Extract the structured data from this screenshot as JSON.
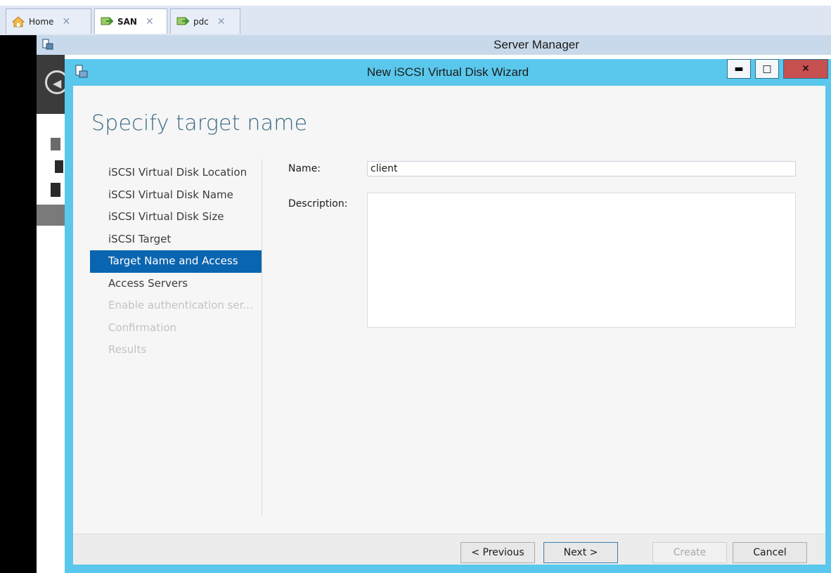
{
  "tabs": [
    {
      "label": "Home",
      "icon": "home-icon",
      "active": false
    },
    {
      "label": "SAN",
      "icon": "vm-icon",
      "active": true
    },
    {
      "label": "pdc",
      "icon": "vm-icon",
      "active": false
    }
  ],
  "tab_close_glyph": "✕",
  "server_manager": {
    "title": "Server Manager"
  },
  "wizard": {
    "title": "New iSCSI Virtual Disk Wizard",
    "heading": "Specify target name",
    "steps": [
      {
        "label": "iSCSI Virtual Disk Location",
        "state": "normal"
      },
      {
        "label": "iSCSI Virtual Disk Name",
        "state": "normal"
      },
      {
        "label": "iSCSI Virtual Disk Size",
        "state": "normal"
      },
      {
        "label": "iSCSI Target",
        "state": "normal"
      },
      {
        "label": "Target Name and Access",
        "state": "active"
      },
      {
        "label": "Access Servers",
        "state": "normal"
      },
      {
        "label": "Enable authentication ser...",
        "state": "disabled"
      },
      {
        "label": "Confirmation",
        "state": "disabled"
      },
      {
        "label": "Results",
        "state": "disabled"
      }
    ],
    "form": {
      "name_label": "Name:",
      "name_value": "client",
      "description_label": "Description:",
      "description_value": ""
    },
    "buttons": {
      "previous": "< Previous",
      "next": "Next >",
      "create": "Create",
      "cancel": "Cancel"
    }
  },
  "colors": {
    "wizard_frame": "#5ac8ec",
    "selected_step": "#0a65b0",
    "heading": "#3a6b84",
    "close_button": "#c75050"
  }
}
